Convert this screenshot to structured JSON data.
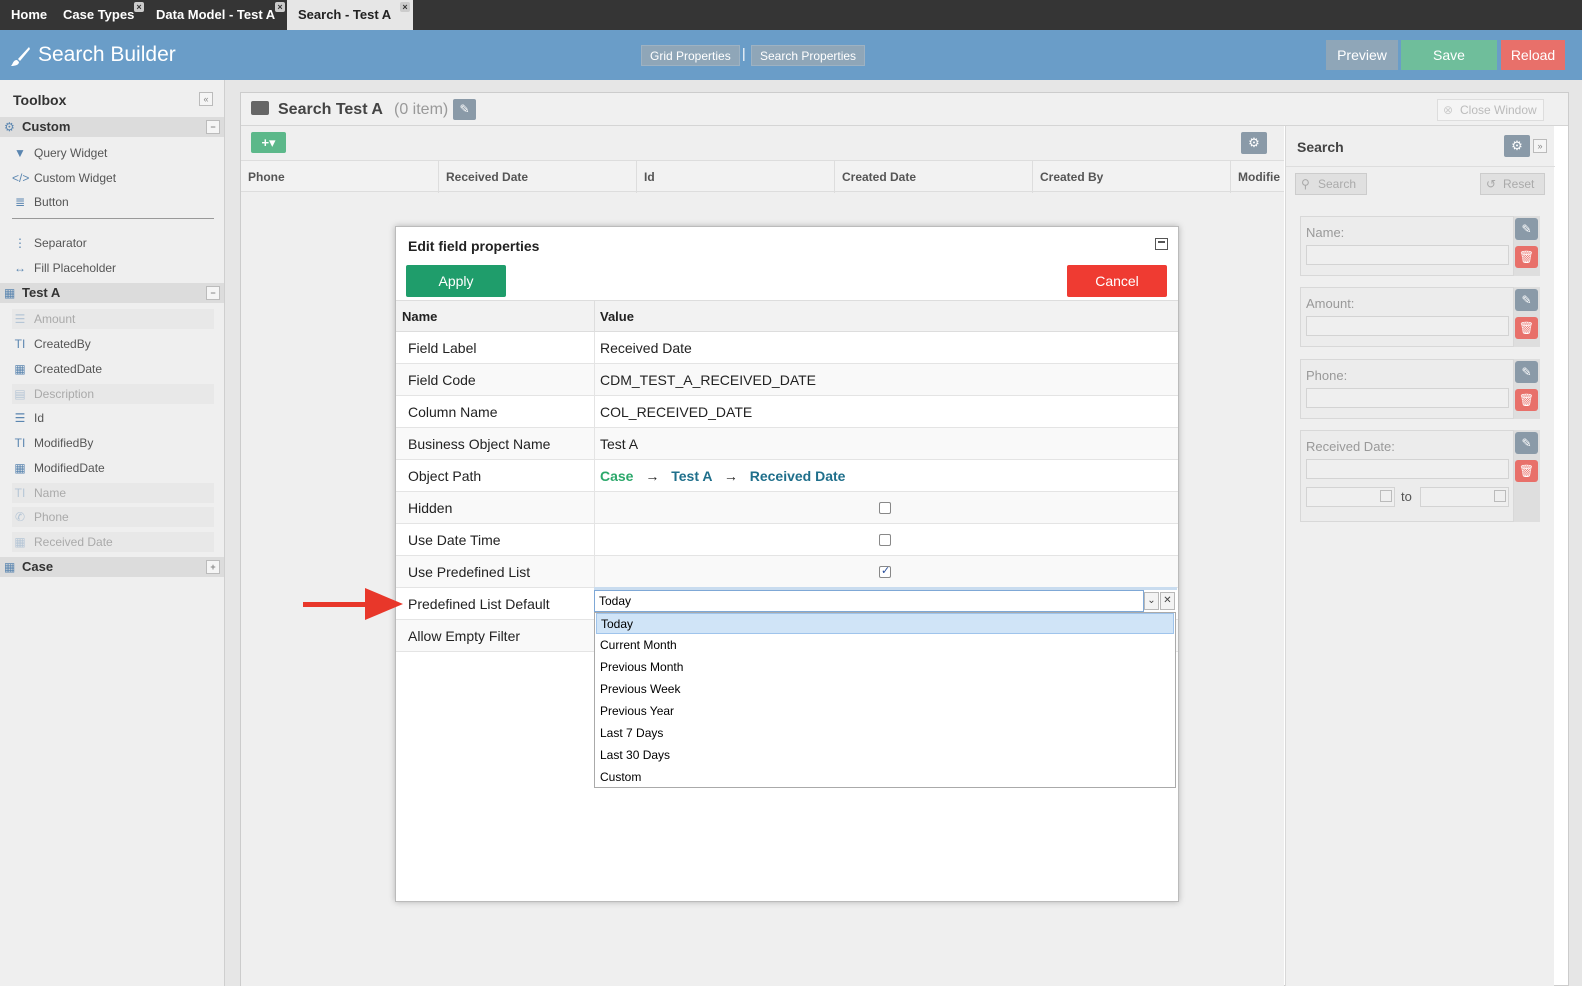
{
  "tabs": [
    {
      "label": "Home",
      "closable": false
    },
    {
      "label": "Case Types",
      "closable": true
    },
    {
      "label": "Data Model - Test A",
      "closable": true
    },
    {
      "label": "Search - Test A",
      "closable": true,
      "active": true
    }
  ],
  "header": {
    "title": "Search Builder",
    "grid_properties": "Grid Properties",
    "separator": "|",
    "search_properties": "Search Properties",
    "preview": "Preview",
    "save": "Save",
    "reload": "Reload",
    "colors": {
      "bar": "#6a9dc8",
      "preview": "#8fa6b8",
      "save": "#6fbe9b",
      "reload": "#e8706a"
    }
  },
  "toolbox": {
    "title": "Toolbox",
    "sections": [
      {
        "label": "Custom",
        "icon": "gears-icon",
        "items": [
          {
            "label": "Query Widget",
            "icon": "filter-icon",
            "enabled": true
          },
          {
            "label": "Custom Widget",
            "icon": "code-icon",
            "enabled": true
          },
          {
            "label": "Button",
            "icon": "database-icon",
            "enabled": true
          },
          {
            "label": "Separator",
            "icon": "vertical-dots-icon",
            "enabled": true
          },
          {
            "label": "Fill Placeholder",
            "icon": "horizontal-arrows-icon",
            "enabled": true
          }
        ]
      },
      {
        "label": "Test A",
        "icon": "table-icon",
        "items": [
          {
            "label": "Amount",
            "icon": "list-icon",
            "enabled": false
          },
          {
            "label": "CreatedBy",
            "icon": "text-icon",
            "enabled": true
          },
          {
            "label": "CreatedDate",
            "icon": "calendar-icon",
            "enabled": true
          },
          {
            "label": "Description",
            "icon": "textarea-icon",
            "enabled": false
          },
          {
            "label": "Id",
            "icon": "list-icon",
            "enabled": true
          },
          {
            "label": "ModifiedBy",
            "icon": "text-icon",
            "enabled": true
          },
          {
            "label": "ModifiedDate",
            "icon": "calendar-icon",
            "enabled": true
          },
          {
            "label": "Name",
            "icon": "text-icon",
            "enabled": false
          },
          {
            "label": "Phone",
            "icon": "phone-icon",
            "enabled": false
          },
          {
            "label": "Received Date",
            "icon": "calendar-icon",
            "enabled": false
          }
        ]
      },
      {
        "label": "Case",
        "icon": "table-icon",
        "items": []
      }
    ]
  },
  "main": {
    "title": "Search Test A",
    "count": "(0 item)",
    "close_window": "Close Window",
    "grid_columns": [
      "Phone",
      "Received Date",
      "Id",
      "Created Date",
      "Created By",
      "Modifie"
    ]
  },
  "search_panel": {
    "title": "Search",
    "search_button": "Search",
    "reset_button": "Reset",
    "fields": [
      {
        "label": "Name:"
      },
      {
        "label": "Amount:"
      },
      {
        "label": "Phone:"
      },
      {
        "label": "Received Date:",
        "range_to": "to"
      }
    ]
  },
  "dialog": {
    "title": "Edit field properties",
    "apply": "Apply",
    "cancel": "Cancel",
    "header_name": "Name",
    "header_value": "Value",
    "rows": [
      {
        "name": "Field Label",
        "value": "Received Date"
      },
      {
        "name": "Field Code",
        "value": "CDM_TEST_A_RECEIVED_DATE"
      },
      {
        "name": "Column Name",
        "value": "COL_RECEIVED_DATE"
      },
      {
        "name": "Business Object Name",
        "value": "Test A"
      },
      {
        "name": "Object Path",
        "value": ""
      },
      {
        "name": "Hidden",
        "checked": false
      },
      {
        "name": "Use Date Time",
        "checked": false
      },
      {
        "name": "Use Predefined List",
        "checked": true
      },
      {
        "name": "Predefined List Default",
        "value": "Today"
      },
      {
        "name": "Allow Empty Filter",
        "value": ""
      }
    ],
    "object_path": {
      "part1": "Case",
      "arrow": "→",
      "part2": "Test A",
      "part3": "Received Date",
      "color1": "#2ca86b",
      "color2": "#1f6f8b"
    },
    "colors": {
      "apply": "#1f9d6b",
      "cancel": "#ef3b32"
    }
  },
  "dropdown": {
    "value": "Today",
    "options": [
      "Today",
      "Current Month",
      "Previous Month",
      "Previous Week",
      "Previous Year",
      "Last 7 Days",
      "Last 30 Days",
      "Custom"
    ],
    "selected_index": 0
  }
}
